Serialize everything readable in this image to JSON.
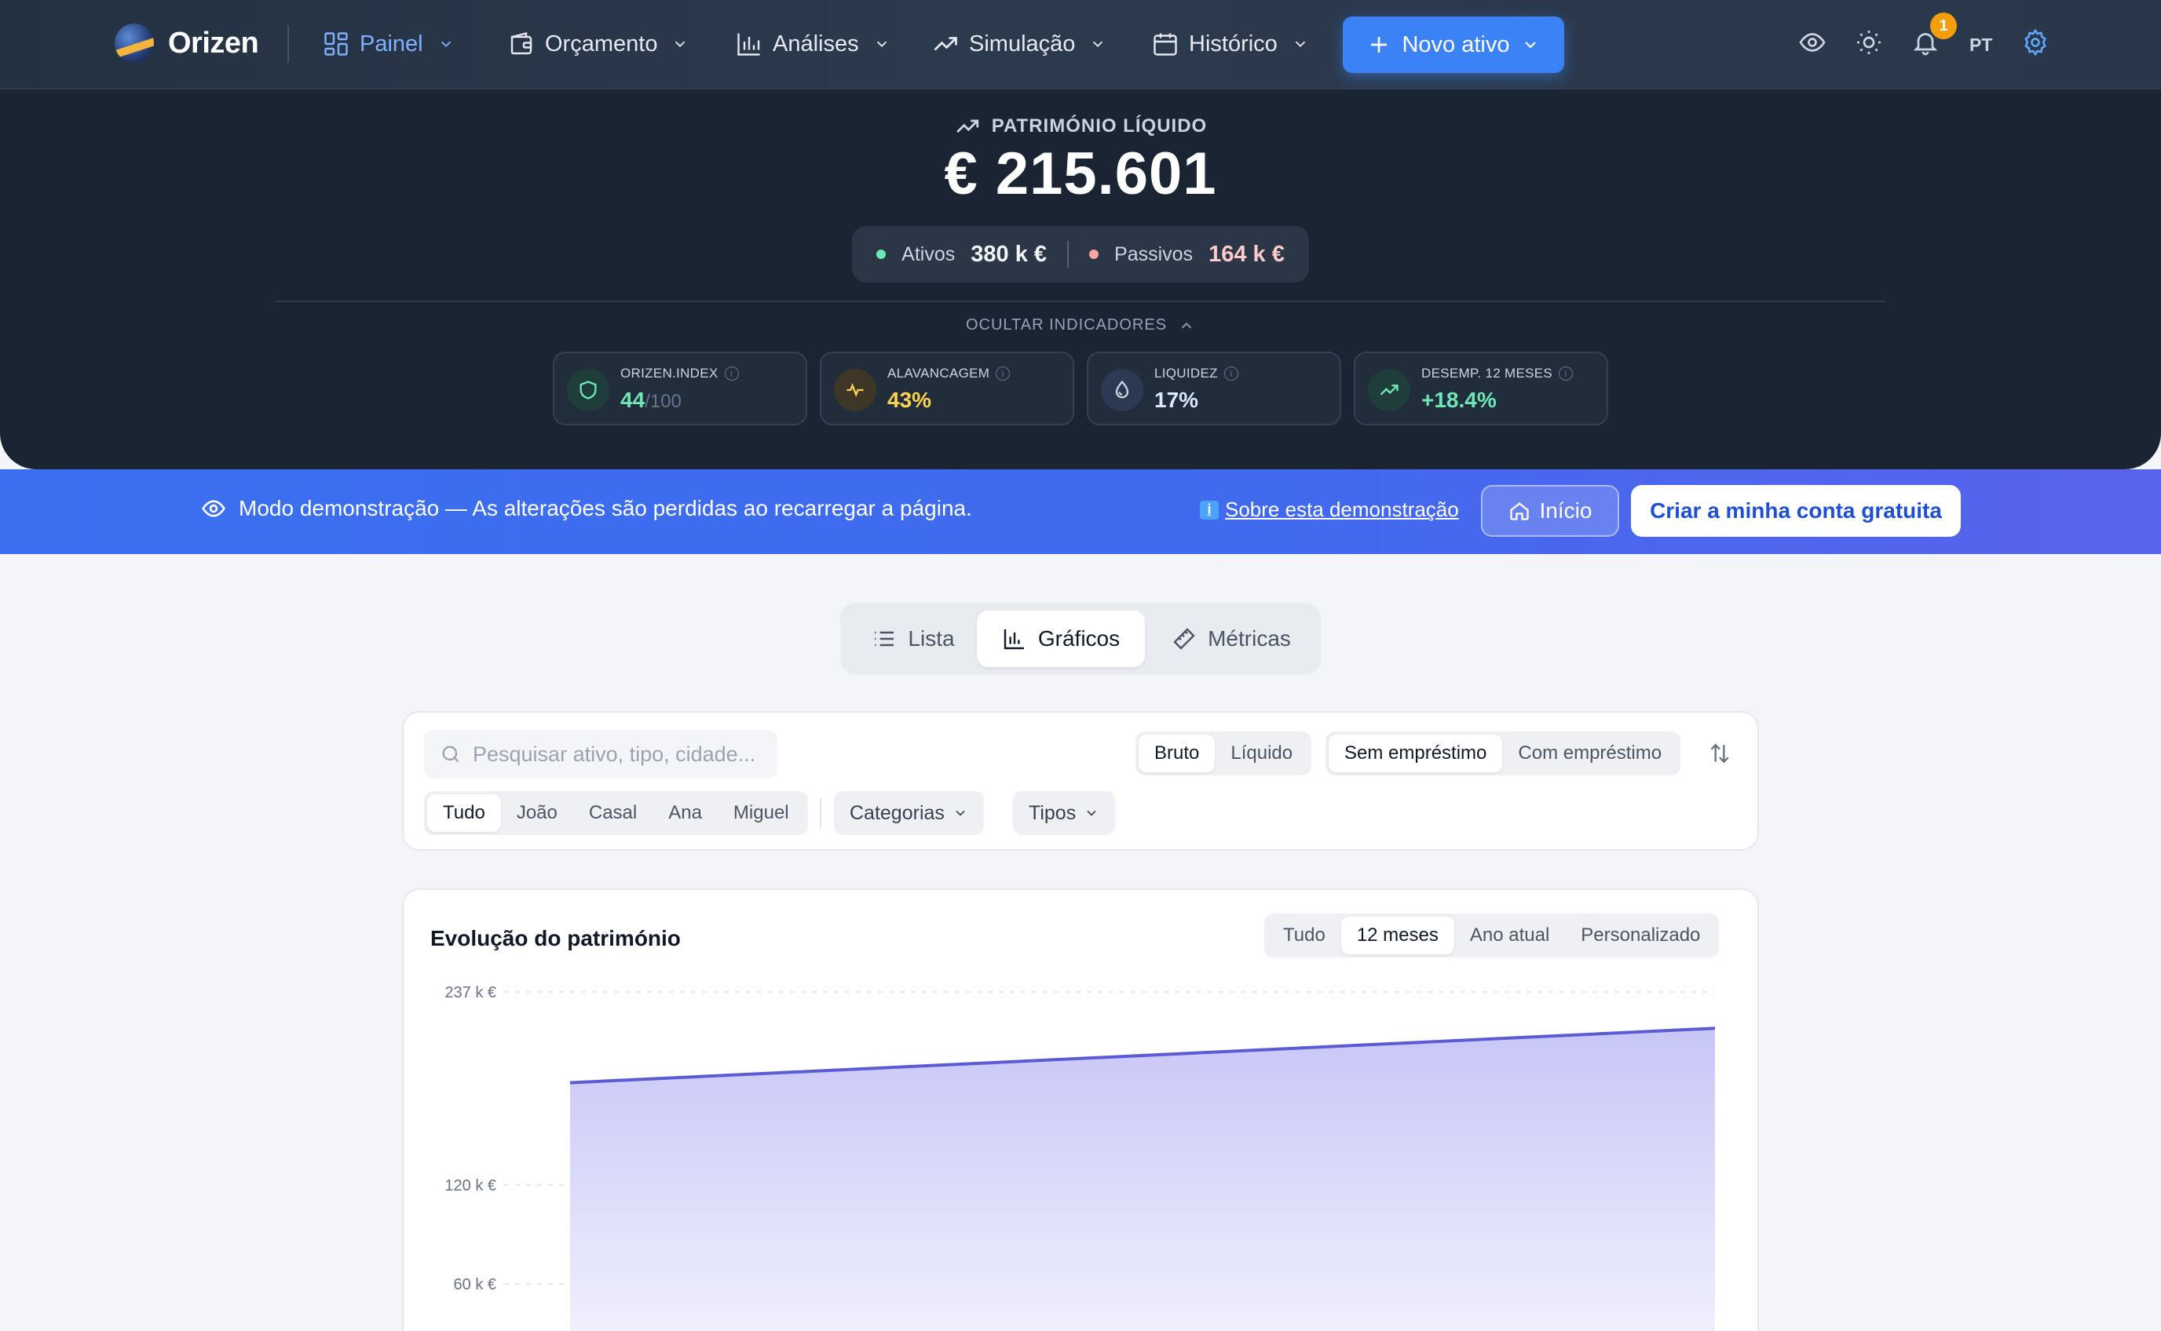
{
  "app": {
    "name": "Orizen"
  },
  "nav": {
    "items": [
      {
        "label": "Painel",
        "icon": "dashboard-icon",
        "active": true
      },
      {
        "label": "Orçamento",
        "icon": "wallet-icon"
      },
      {
        "label": "Análises",
        "icon": "bar-chart-icon"
      },
      {
        "label": "Simulação",
        "icon": "trend-up-icon"
      },
      {
        "label": "Histórico",
        "icon": "calendar-icon"
      }
    ],
    "new_asset_label": "Novo ativo",
    "notification_count": "1",
    "language": "PT"
  },
  "net_worth": {
    "label": "PATRIMÓNIO LÍQUIDO",
    "value": "€ 215.601",
    "assets_label": "Ativos",
    "assets_value": "380 k €",
    "liabilities_label": "Passivos",
    "liabilities_value": "164 k €",
    "toggle_label": "OCULTAR INDICADORES"
  },
  "indicators": [
    {
      "label": "ORIZEN.INDEX",
      "value": "44",
      "suffix": "/100",
      "color": "#6ee7b7"
    },
    {
      "label": "ALAVANCAGEM",
      "value": "43%",
      "color": "#fcd34d"
    },
    {
      "label": "LIQUIDEZ",
      "value": "17%",
      "color": "#93c5fd"
    },
    {
      "label": "DESEMP. 12 MESES",
      "value": "+18.4%",
      "color": "#6ee7b7"
    }
  ],
  "banner": {
    "text": "Modo demonstração — As alterações são perdidas ao recarregar a página.",
    "link": "Sobre esta demonstração",
    "home_label": "Início",
    "cta_label": "Criar a minha conta gratuita"
  },
  "view_tabs": [
    {
      "label": "Lista"
    },
    {
      "label": "Gráficos",
      "active": true
    },
    {
      "label": "Métricas"
    }
  ],
  "filters": {
    "search_placeholder": "Pesquisar ativo, tipo, cidade...",
    "gross_net": [
      "Bruto",
      "Líquido"
    ],
    "loan": [
      "Sem empréstimo",
      "Com empréstimo"
    ],
    "people": [
      "Tudo",
      "João",
      "Casal",
      "Ana",
      "Miguel"
    ],
    "categories_label": "Categorias",
    "types_label": "Tipos"
  },
  "chart_data": {
    "type": "area",
    "title": "Evolução do património",
    "ranges": [
      "Tudo",
      "12 meses",
      "Ano atual",
      "Personalizado"
    ],
    "active_range": "12 meses",
    "y_ticks": [
      "237 k €",
      "120 k €",
      "60 k €"
    ],
    "y_tick_values": [
      237,
      120,
      60
    ],
    "series": [
      {
        "values": [
          182,
          215
        ]
      }
    ],
    "color": "#5b5bd6",
    "grid": true
  }
}
